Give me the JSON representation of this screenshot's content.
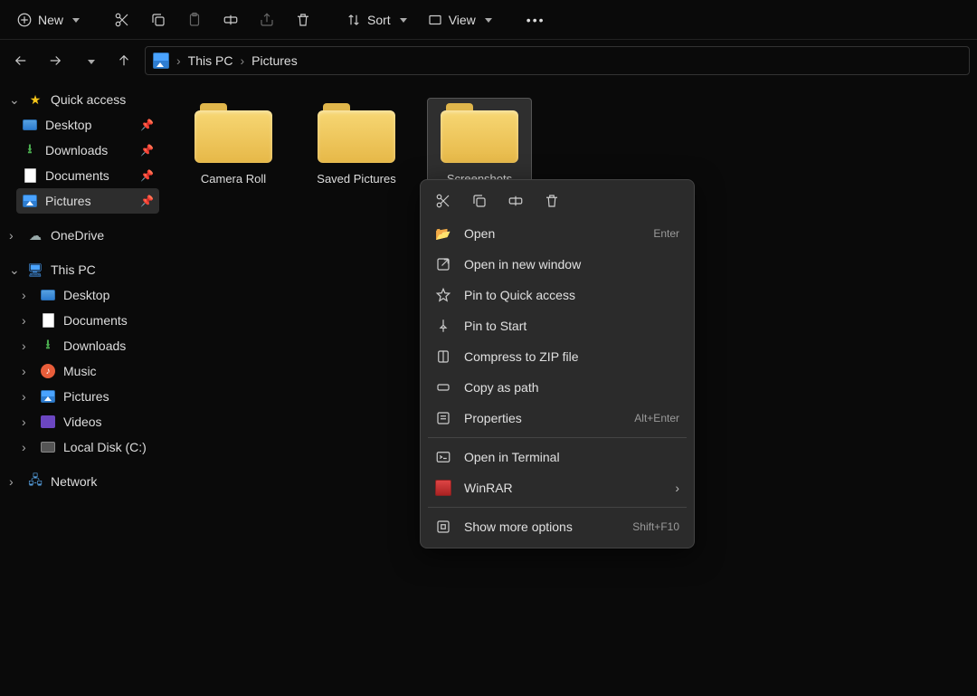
{
  "toolbar": {
    "new_label": "New",
    "sort_label": "Sort",
    "view_label": "View"
  },
  "breadcrumb": {
    "root": "This PC",
    "current": "Pictures"
  },
  "sidebar": {
    "quick_access": "Quick access",
    "desktop": "Desktop",
    "downloads": "Downloads",
    "documents": "Documents",
    "pictures": "Pictures",
    "onedrive": "OneDrive",
    "this_pc": "This PC",
    "pc_desktop": "Desktop",
    "pc_documents": "Documents",
    "pc_downloads": "Downloads",
    "pc_music": "Music",
    "pc_pictures": "Pictures",
    "pc_videos": "Videos",
    "pc_localdisk": "Local Disk (C:)",
    "network": "Network"
  },
  "folders": {
    "f0": "Camera Roll",
    "f1": "Saved Pictures",
    "f2": "Screenshots"
  },
  "ctx": {
    "open": "Open",
    "open_sc": "Enter",
    "open_new": "Open in new window",
    "pin_qa": "Pin to Quick access",
    "pin_start": "Pin to Start",
    "zip": "Compress to ZIP file",
    "copy_path": "Copy as path",
    "properties": "Properties",
    "properties_sc": "Alt+Enter",
    "terminal": "Open in Terminal",
    "winrar": "WinRAR",
    "more": "Show more options",
    "more_sc": "Shift+F10"
  }
}
